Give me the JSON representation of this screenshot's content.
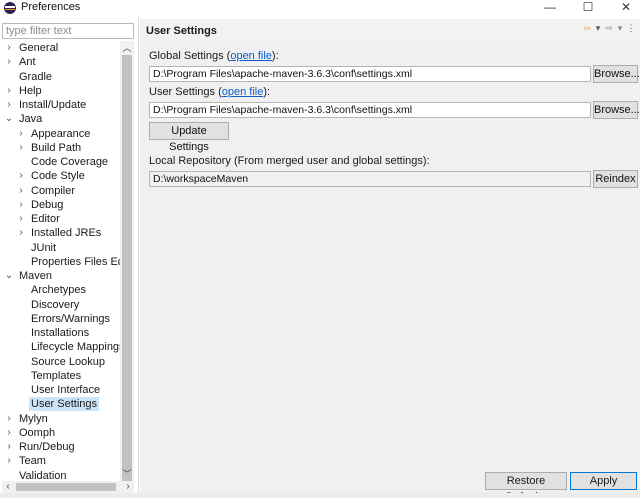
{
  "window": {
    "title": "Preferences",
    "minimize_glyph": "—",
    "maximize_glyph": "☐",
    "close_glyph": "✕"
  },
  "filter": {
    "placeholder": "type filter text",
    "value": ""
  },
  "tree": [
    {
      "label": "General",
      "level": 0,
      "twisty": "›"
    },
    {
      "label": "Ant",
      "level": 0,
      "twisty": "›"
    },
    {
      "label": "Gradle",
      "level": 0,
      "twisty": ""
    },
    {
      "label": "Help",
      "level": 0,
      "twisty": "›"
    },
    {
      "label": "Install/Update",
      "level": 0,
      "twisty": "›"
    },
    {
      "label": "Java",
      "level": 0,
      "twisty": "⌄"
    },
    {
      "label": "Appearance",
      "level": 1,
      "twisty": "›"
    },
    {
      "label": "Build Path",
      "level": 1,
      "twisty": "›"
    },
    {
      "label": "Code Coverage",
      "level": 1,
      "twisty": ""
    },
    {
      "label": "Code Style",
      "level": 1,
      "twisty": "›"
    },
    {
      "label": "Compiler",
      "level": 1,
      "twisty": "›"
    },
    {
      "label": "Debug",
      "level": 1,
      "twisty": "›"
    },
    {
      "label": "Editor",
      "level": 1,
      "twisty": "›"
    },
    {
      "label": "Installed JREs",
      "level": 1,
      "twisty": "›"
    },
    {
      "label": "JUnit",
      "level": 1,
      "twisty": ""
    },
    {
      "label": "Properties Files Edit",
      "level": 1,
      "twisty": ""
    },
    {
      "label": "Maven",
      "level": 0,
      "twisty": "⌄"
    },
    {
      "label": "Archetypes",
      "level": 1,
      "twisty": ""
    },
    {
      "label": "Discovery",
      "level": 1,
      "twisty": ""
    },
    {
      "label": "Errors/Warnings",
      "level": 1,
      "twisty": ""
    },
    {
      "label": "Installations",
      "level": 1,
      "twisty": ""
    },
    {
      "label": "Lifecycle Mappings",
      "level": 1,
      "twisty": ""
    },
    {
      "label": "Source Lookup",
      "level": 1,
      "twisty": ""
    },
    {
      "label": "Templates",
      "level": 1,
      "twisty": ""
    },
    {
      "label": "User Interface",
      "level": 1,
      "twisty": ""
    },
    {
      "label": "User Settings",
      "level": 1,
      "twisty": "",
      "selected": true
    },
    {
      "label": "Mylyn",
      "level": 0,
      "twisty": "›"
    },
    {
      "label": "Oomph",
      "level": 0,
      "twisty": "›"
    },
    {
      "label": "Run/Debug",
      "level": 0,
      "twisty": "›"
    },
    {
      "label": "Team",
      "level": 0,
      "twisty": "›"
    },
    {
      "label": "Validation",
      "level": 0,
      "twisty": ""
    }
  ],
  "page": {
    "title": "User Settings",
    "global_label_prefix": "Global Settings (",
    "global_link": "open file",
    "global_label_suffix": "):",
    "global_value": "D:\\Program Files\\apache-maven-3.6.3\\conf\\settings.xml",
    "user_label_prefix": "User Settings (",
    "user_link": "open file",
    "user_label_suffix": "):",
    "user_value": "D:\\Program Files\\apache-maven-3.6.3\\conf\\settings.xml",
    "browse_label": "Browse...",
    "update_label": "Update Settings",
    "local_repo_label": "Local Repository (From merged user and global settings):",
    "local_repo_value": "D:\\workspaceMaven",
    "reindex_label": "Reindex"
  },
  "buttons": {
    "restore_defaults": "Restore Defaults",
    "apply": "Apply"
  },
  "colors": {
    "accent": "#0078d7",
    "link": "#0b5cc6",
    "selection": "#cce4f7"
  }
}
